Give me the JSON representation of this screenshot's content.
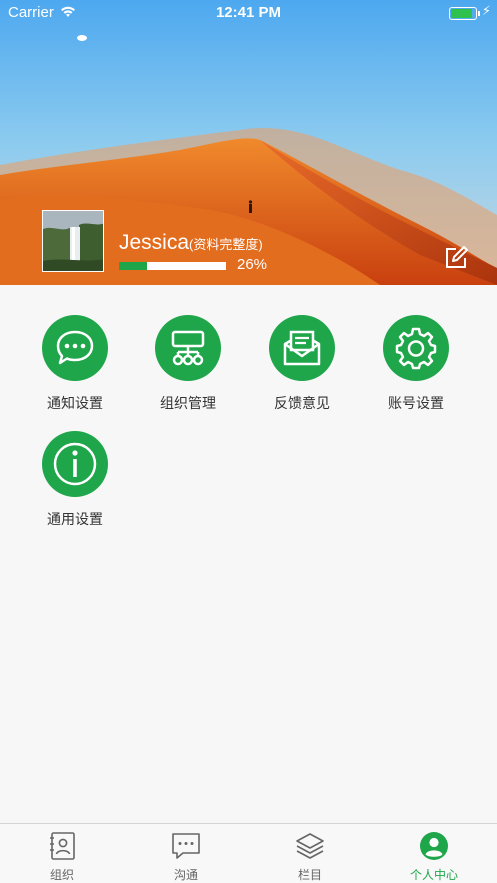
{
  "status_bar": {
    "carrier": "Carrier",
    "time": "12:41 PM",
    "battery_level": 0.9
  },
  "profile": {
    "name": "Jessica",
    "completeness_label": "(资料完整度)",
    "completeness_percent": 26,
    "completeness_text": "26%"
  },
  "menu": [
    {
      "label": "通知设置",
      "icon": "chat-bubble-icon"
    },
    {
      "label": "组织管理",
      "icon": "org-chart-icon"
    },
    {
      "label": "反馈意见",
      "icon": "envelope-icon"
    },
    {
      "label": "账号设置",
      "icon": "gear-icon"
    },
    {
      "label": "通用设置",
      "icon": "info-icon"
    }
  ],
  "tabs": [
    {
      "label": "组织",
      "icon": "contacts-book-icon",
      "active": false
    },
    {
      "label": "沟通",
      "icon": "chat-icon",
      "active": false
    },
    {
      "label": "栏目",
      "icon": "layers-icon",
      "active": false
    },
    {
      "label": "个人中心",
      "icon": "user-circle-icon",
      "active": true
    }
  ],
  "colors": {
    "accent": "#1fa64a",
    "tab_inactive": "#666666",
    "background": "#f7f7f7"
  }
}
